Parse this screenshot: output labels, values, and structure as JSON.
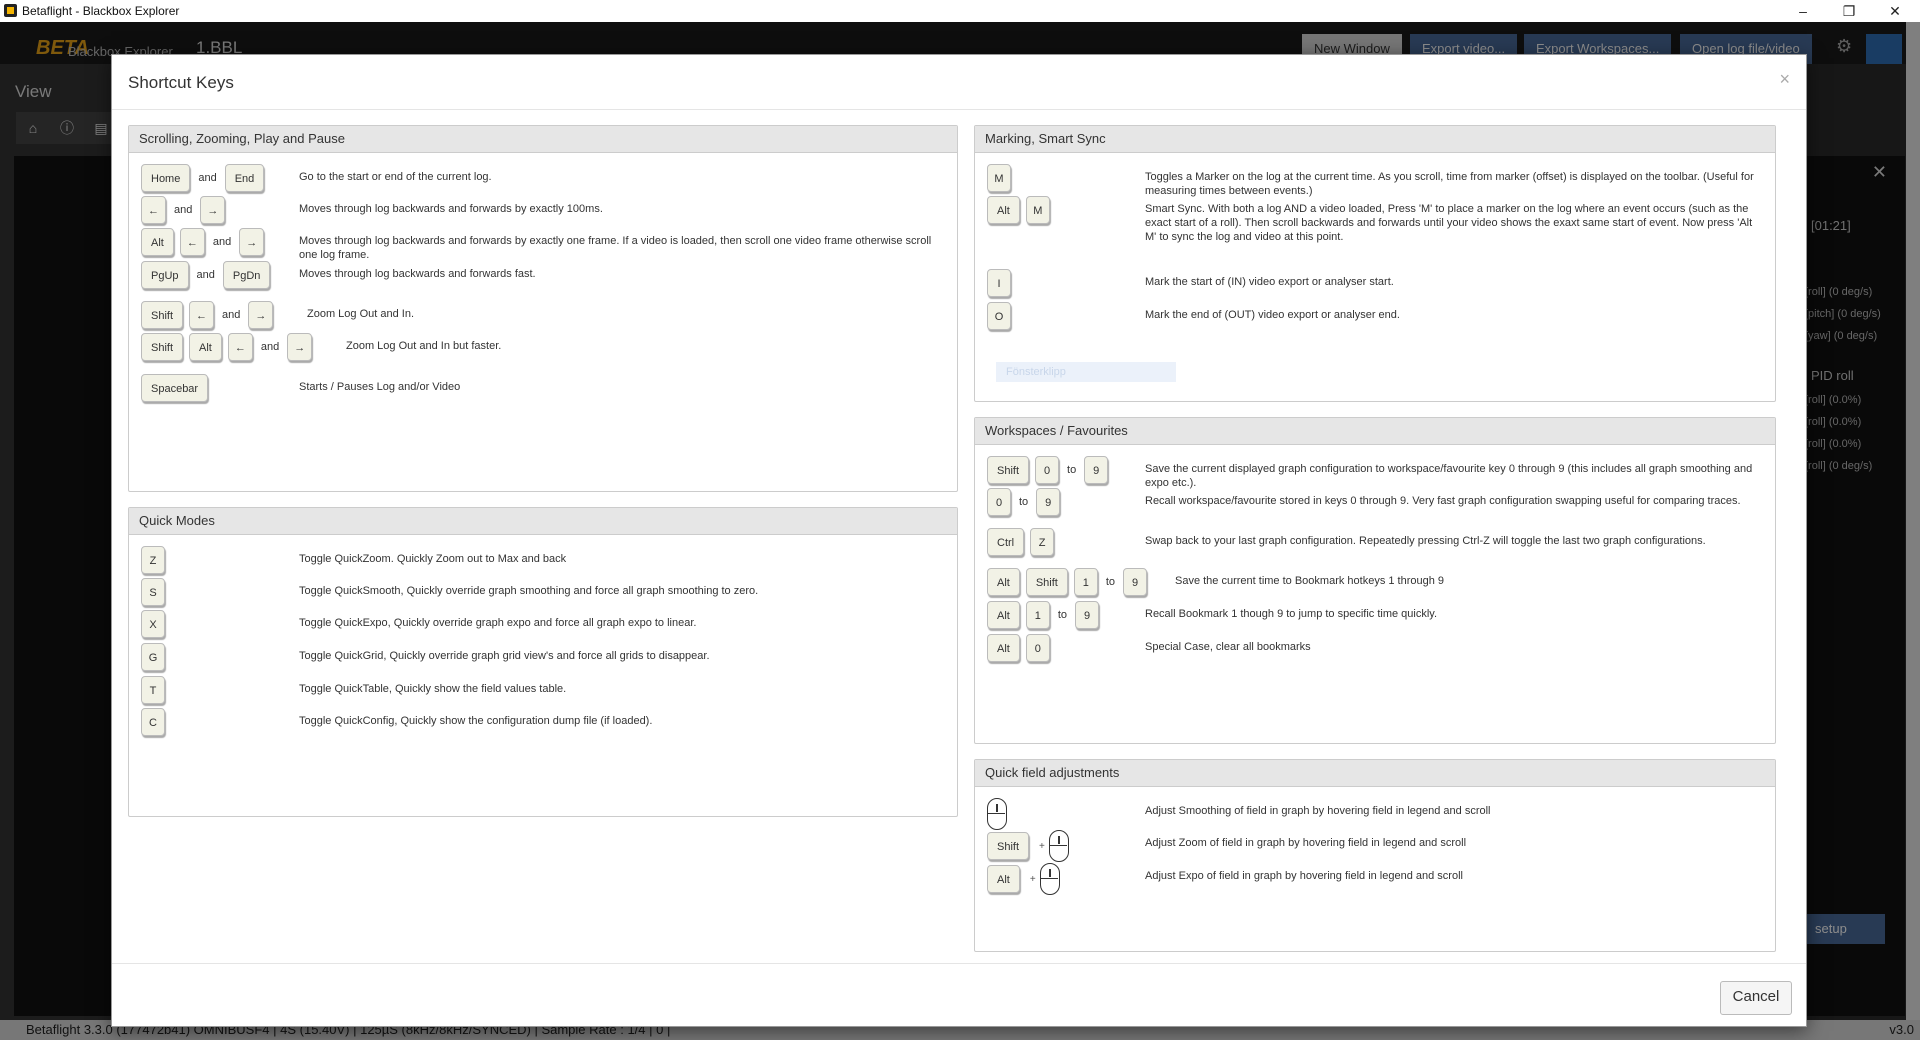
{
  "window": {
    "title": "Betaflight - Blackbox Explorer",
    "min": "–",
    "max": "❐",
    "close": "✕"
  },
  "app": {
    "logo": "BETA",
    "logo_sub": "Blackbox Explorer",
    "log_file": "1.BBL",
    "buttons": [
      "New Window",
      "Export video...",
      "Export Workspaces...",
      "Open log file/video"
    ],
    "view_label": "View",
    "status_left": "Betaflight 3.3.0 (177472b41) OMNIBUSF4 | 4S (15.40V) | 125µS (8kHz/8kHz/SYNCED) | Sample Rate : 1/4 | 0 |",
    "status_right": "v3.0",
    "right_panel": {
      "time": "[01:21]",
      "lines": [
        "[roll] (0 deg/s)",
        "[pitch] (0 deg/s)",
        "[yaw] (0 deg/s)"
      ],
      "pid_title": "PID roll",
      "pid_lines": [
        "[roll] (0.0%)",
        "[roll] (0.0%)",
        "[roll] (0.0%)",
        "[roll] (0 deg/s)"
      ],
      "setup": "setup"
    }
  },
  "modal": {
    "title": "Shortcut Keys",
    "close": "×",
    "cancel": "Cancel",
    "ghost_text": "Fönsterklipp",
    "sections": {
      "scroll": {
        "title": "Scrolling, Zooming, Play and Pause",
        "rows": [
          {
            "keys": [
              "Home",
              "and",
              "End"
            ],
            "desc": "Go to the start or end of the current log."
          },
          {
            "keys": [
              "←",
              "and",
              "→"
            ],
            "desc": "Moves through log backwards and forwards by exactly 100ms."
          },
          {
            "keys": [
              "Alt",
              "←",
              "and",
              "→"
            ],
            "desc": "Moves through log backwards and forwards by exactly one frame. If a video is loaded, then scroll one video frame otherwise scroll one log frame."
          },
          {
            "keys": [
              "PgUp",
              "and",
              "PgDn"
            ],
            "desc": "Moves through log backwards and forwards fast."
          },
          {
            "keys": [
              "Shift",
              "←",
              "and",
              "→"
            ],
            "desc": "Zoom Log Out and In."
          },
          {
            "keys": [
              "Shift",
              "Alt",
              "←",
              "and",
              "→"
            ],
            "desc": "Zoom Log Out and In but faster."
          },
          {
            "keys": [
              "Spacebar"
            ],
            "desc": "Starts / Pauses Log and/or Video"
          }
        ]
      },
      "quick": {
        "title": "Quick Modes",
        "rows": [
          {
            "keys": [
              "Z"
            ],
            "desc": "Toggle QuickZoom. Quickly Zoom out to Max and back"
          },
          {
            "keys": [
              "S"
            ],
            "desc": "Toggle QuickSmooth, Quickly override graph smoothing and force all graph smoothing to zero."
          },
          {
            "keys": [
              "X"
            ],
            "desc": "Toggle QuickExpo, Quickly override graph expo and force all graph expo to linear."
          },
          {
            "keys": [
              "G"
            ],
            "desc": "Toggle QuickGrid, Quickly override graph grid view's and force all grids to disappear."
          },
          {
            "keys": [
              "T"
            ],
            "desc": "Toggle QuickTable, Quickly show the field values table."
          },
          {
            "keys": [
              "C"
            ],
            "desc": "Toggle QuickConfig, Quickly show the configuration dump file (if loaded)."
          }
        ]
      },
      "marking": {
        "title": "Marking, Smart Sync",
        "rows": [
          {
            "keys": [
              "M"
            ],
            "desc": "Toggles a Marker on the log at the current time. As you scroll, time from marker (offset) is displayed on the toolbar. (Useful for measuring times between events.)"
          },
          {
            "keys": [
              "Alt",
              "M"
            ],
            "desc": "Smart Sync. With both a log AND a video loaded, Press 'M' to place a marker on the log where an event occurs (such as the exact start of a roll). Then scroll backwards and forwards until your video shows the exaxt same start of event. Now press 'Alt M' to sync the log and video at this point."
          },
          {
            "keys": [
              "I"
            ],
            "desc": "Mark the start of (IN) video export or analyser start."
          },
          {
            "keys": [
              "O"
            ],
            "desc": "Mark the end of (OUT) video export or analyser end."
          }
        ]
      },
      "workspaces": {
        "title": "Workspaces / Favourites",
        "rows": [
          {
            "keys": [
              "Shift",
              "0",
              "to",
              "9"
            ],
            "desc": "Save the current displayed graph configuration to workspace/favourite key 0 through 9 (this includes all graph smoothing and expo etc.)."
          },
          {
            "keys": [
              "0",
              "to",
              "9"
            ],
            "desc": "Recall workspace/favourite stored in keys 0 through 9. Very fast graph configuration swapping useful for comparing traces."
          },
          {
            "keys": [
              "Ctrl",
              "Z"
            ],
            "desc": "Swap back to your last graph configuration. Repeatedly pressing Ctrl-Z will toggle the last two graph configurations."
          },
          {
            "keys": [
              "Alt",
              "Shift",
              "1",
              "to",
              "9"
            ],
            "desc": "Save the current time to Bookmark hotkeys 1 through 9"
          },
          {
            "keys": [
              "Alt",
              "1",
              "to",
              "9"
            ],
            "desc": "Recall Bookmark 1 though 9 to jump to specific time quickly."
          },
          {
            "keys": [
              "Alt",
              "0"
            ],
            "desc": "Special Case, clear all bookmarks"
          }
        ]
      },
      "field": {
        "title": "Quick field adjustments",
        "rows": [
          {
            "keys": [],
            "desc": "Adjust Smoothing of field in graph by hovering field in legend and scroll"
          },
          {
            "keys": [
              "Shift"
            ],
            "desc": "Adjust Zoom of field in graph by hovering field in legend and scroll"
          },
          {
            "keys": [
              "Alt"
            ],
            "desc": "Adjust Expo of field in graph by hovering field in legend and scroll"
          }
        ],
        "plus": "+"
      }
    }
  }
}
